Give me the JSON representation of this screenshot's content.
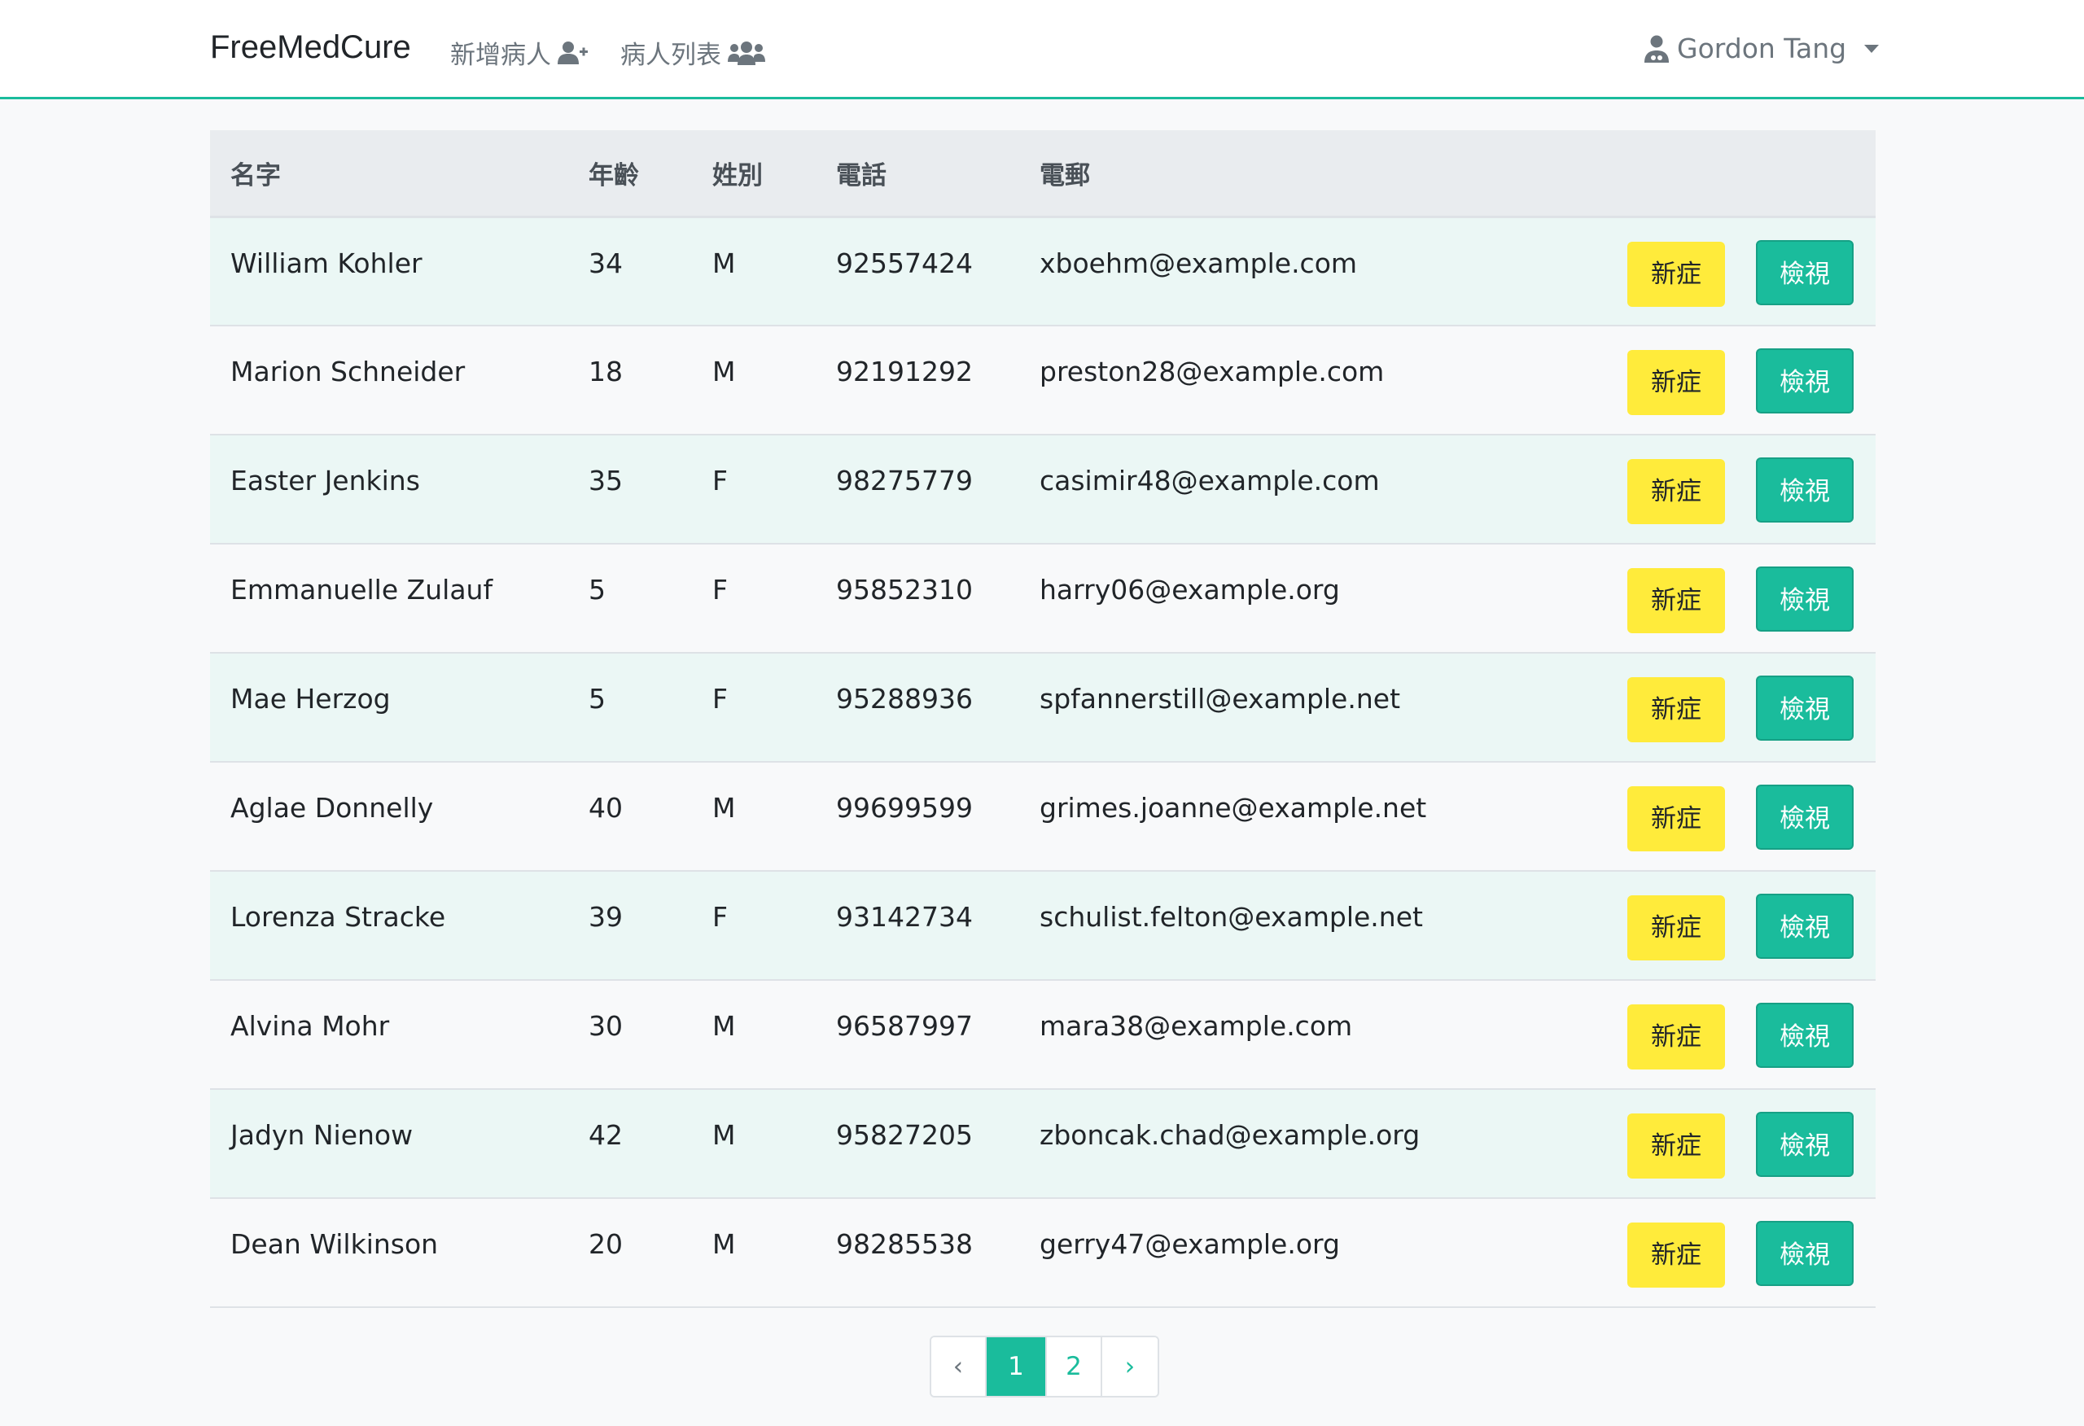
{
  "navbar": {
    "brand": "FreeMedCure",
    "add_patient": "新增病人",
    "patient_list": "病人列表",
    "user_name": "Gordon Tang"
  },
  "table": {
    "headers": [
      "名字",
      "年齡",
      "姓別",
      "電話",
      "電郵"
    ],
    "rows": [
      {
        "name": "William Kohler",
        "age": "34",
        "sex": "M",
        "phone": "92557424",
        "email": "xboehm@example.com"
      },
      {
        "name": "Marion Schneider",
        "age": "18",
        "sex": "M",
        "phone": "92191292",
        "email": "preston28@example.com"
      },
      {
        "name": "Easter Jenkins",
        "age": "35",
        "sex": "F",
        "phone": "98275779",
        "email": "casimir48@example.com"
      },
      {
        "name": "Emmanuelle Zulauf",
        "age": "5",
        "sex": "F",
        "phone": "95852310",
        "email": "harry06@example.org"
      },
      {
        "name": "Mae Herzog",
        "age": "5",
        "sex": "F",
        "phone": "95288936",
        "email": "spfannerstill@example.net"
      },
      {
        "name": "Aglae Donnelly",
        "age": "40",
        "sex": "M",
        "phone": "99699599",
        "email": "grimes.joanne@example.net"
      },
      {
        "name": "Lorenza Stracke",
        "age": "39",
        "sex": "F",
        "phone": "93142734",
        "email": "schulist.felton@example.net"
      },
      {
        "name": "Alvina Mohr",
        "age": "30",
        "sex": "M",
        "phone": "96587997",
        "email": "mara38@example.com"
      },
      {
        "name": "Jadyn Nienow",
        "age": "42",
        "sex": "M",
        "phone": "95827205",
        "email": "zboncak.chad@example.org"
      },
      {
        "name": "Dean Wilkinson",
        "age": "20",
        "sex": "M",
        "phone": "98285538",
        "email": "gerry47@example.org"
      }
    ],
    "new_case_label": "新症",
    "view_label": "檢視"
  },
  "pagination": {
    "prev": "‹",
    "pages": [
      "1",
      "2"
    ],
    "active_page": "1",
    "next": "›"
  },
  "colors": {
    "accent": "#1abc9c",
    "new_case_button": "#ffeb3b",
    "row_stripe": "#ebf7f5"
  },
  "icons": {
    "add_patient": "user-plus-icon",
    "patient_list": "users-icon",
    "user": "user-doctor-icon"
  }
}
